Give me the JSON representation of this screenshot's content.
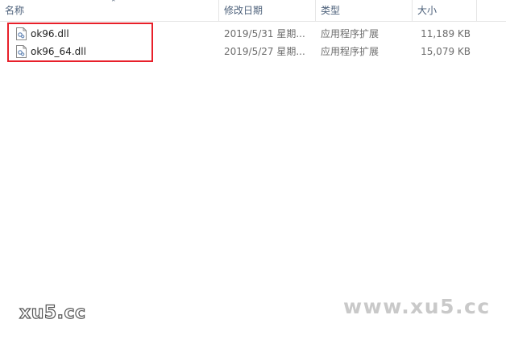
{
  "columns": {
    "name": "名称",
    "date": "修改日期",
    "type": "类型",
    "size": "大小"
  },
  "files": [
    {
      "name": "ok96.dll",
      "date": "2019/5/31 星期...",
      "type": "应用程序扩展",
      "size": "11,189 KB",
      "icon": "dll-file-icon"
    },
    {
      "name": "ok96_64.dll",
      "date": "2019/5/27 星期...",
      "type": "应用程序扩展",
      "size": "15,079 KB",
      "icon": "dll-file-icon"
    }
  ],
  "watermarks": {
    "left": "xu5.cc",
    "right": "www.xu5.cc"
  },
  "colors": {
    "highlight": "#e8202a",
    "header_text": "#4c607a"
  }
}
